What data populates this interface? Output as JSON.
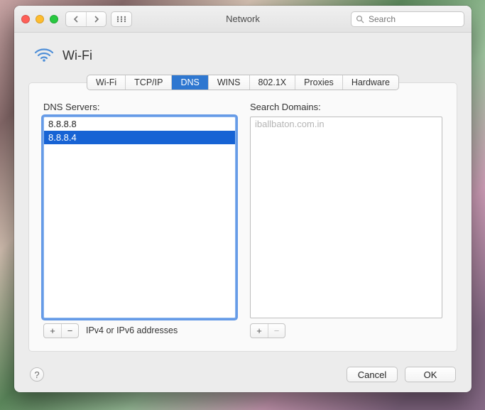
{
  "window": {
    "title": "Network"
  },
  "search": {
    "placeholder": "Search",
    "value": ""
  },
  "connection": {
    "name": "Wi-Fi"
  },
  "tabs": {
    "items": [
      {
        "label": "Wi-Fi"
      },
      {
        "label": "TCP/IP"
      },
      {
        "label": "DNS"
      },
      {
        "label": "WINS"
      },
      {
        "label": "802.1X"
      },
      {
        "label": "Proxies"
      },
      {
        "label": "Hardware"
      }
    ],
    "active_index": 2
  },
  "dns": {
    "servers_label": "DNS Servers:",
    "servers": [
      {
        "value": "8.8.8.8",
        "selected": false
      },
      {
        "value": "8.8.8.4",
        "selected": true
      }
    ],
    "hint": "IPv4 or IPv6 addresses",
    "add_label": "+",
    "remove_label": "−",
    "remove_enabled": true,
    "domains_label": "Search Domains:",
    "domains": [
      {
        "value": "iballbaton.com.in",
        "dim": true
      }
    ],
    "domains_remove_enabled": false
  },
  "footer": {
    "help": "?",
    "cancel": "Cancel",
    "ok": "OK"
  }
}
